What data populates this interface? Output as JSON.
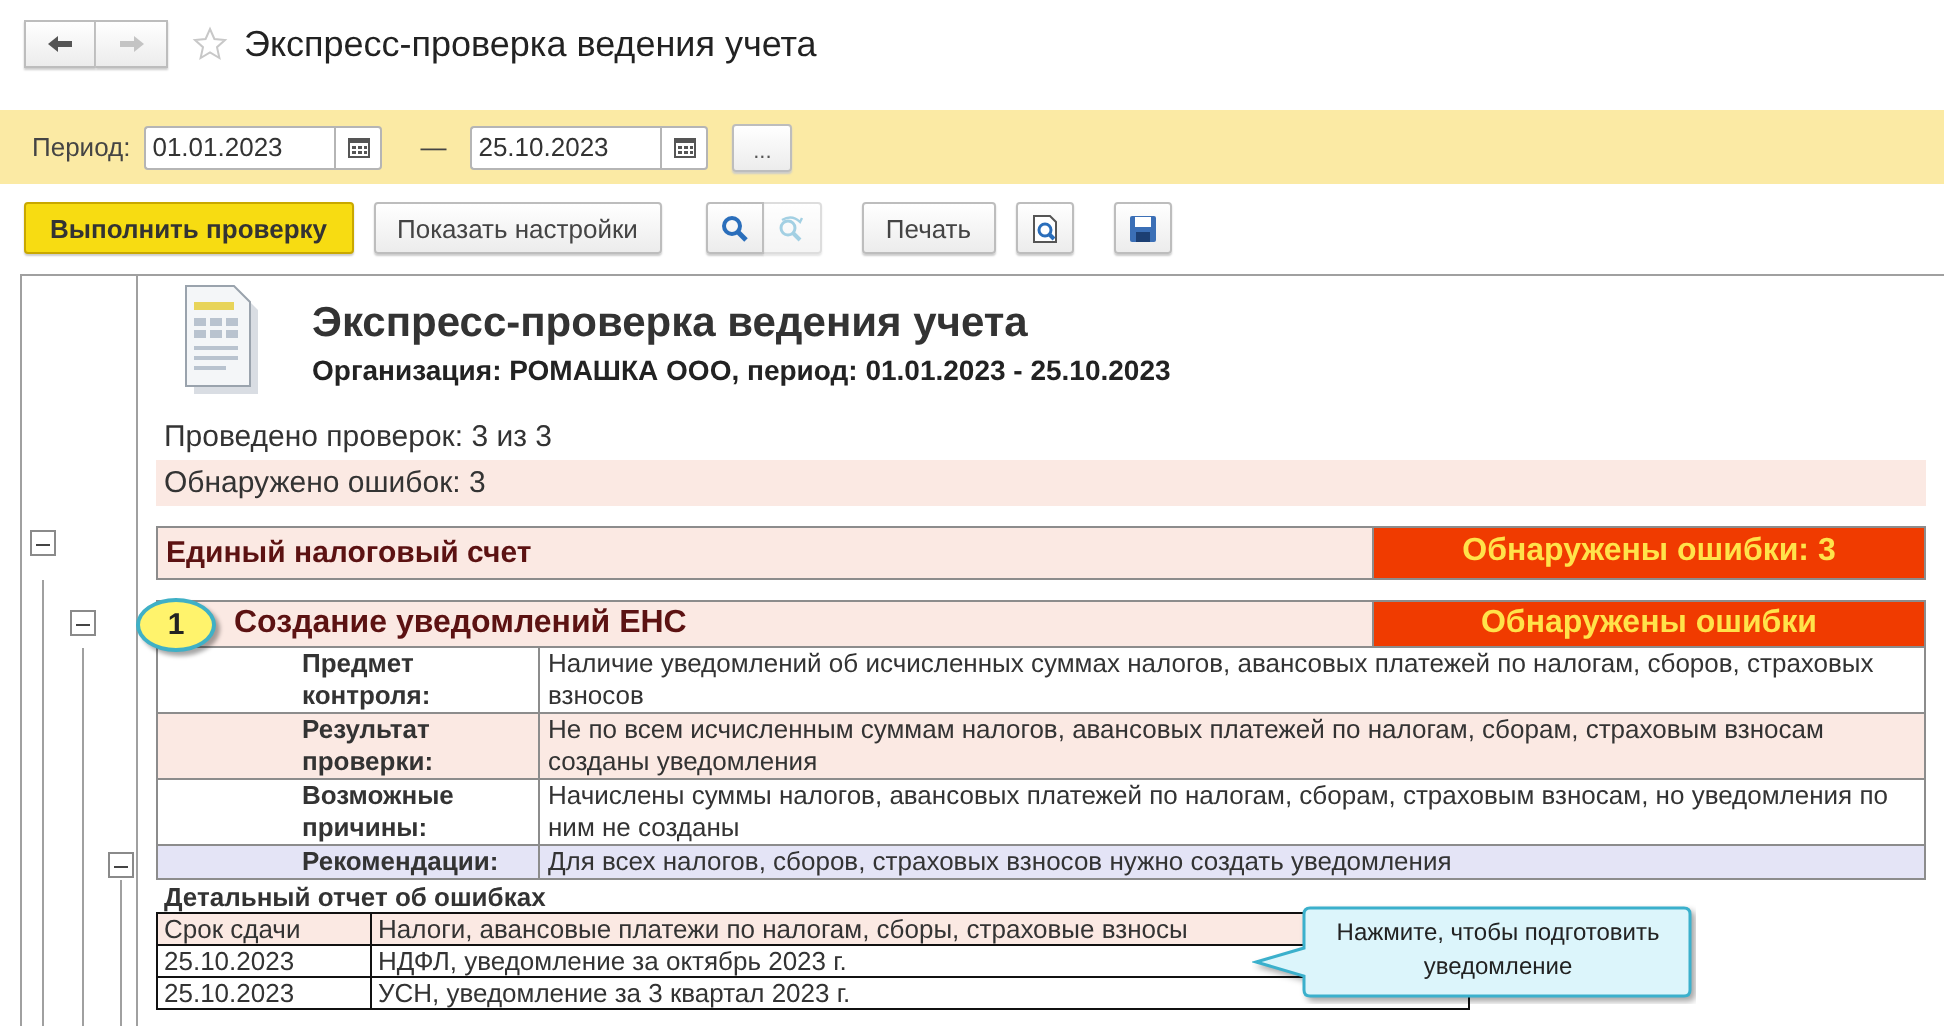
{
  "window": {
    "title": "Экспресс-проверка ведения учета"
  },
  "nav": [
    {
      "kind": "back",
      "disabled": false
    },
    {
      "kind": "forward",
      "disabled": true
    }
  ],
  "period": {
    "label": "Период:",
    "from": "01.01.2023",
    "separator": "—",
    "to": "25.10.2023",
    "more_button": "..."
  },
  "toolbar": [
    {
      "kind": "primary",
      "label": "Выполнить проверку"
    },
    {
      "kind": "button",
      "label": "Показать настройки"
    },
    {
      "kind": "search",
      "disabled": false
    },
    {
      "kind": "search-next",
      "disabled": true
    },
    {
      "kind": "button",
      "label": "Печать"
    },
    {
      "kind": "preview",
      "disabled": false
    },
    {
      "kind": "save",
      "disabled": false
    }
  ],
  "report": {
    "title": "Экспресс-проверка ведения учета",
    "subtitle": "Организация: РОМАШКА ООО, период: 01.01.2023 - 25.10.2023",
    "checks_done": "Проведено проверок: 3 из 3",
    "errors_found": "Обнаружено ошибок: 3",
    "sections": [
      {
        "title": "Единый налоговый счет",
        "status": "Обнаружены ошибки: 3",
        "expanded": true,
        "items": [
          {
            "marker": "1",
            "title": "Создание уведомлений ЕНС",
            "status": "Обнаружены ошибки",
            "expanded": true,
            "details": [
              {
                "kind": "subject",
                "label": "Предмет контроля:",
                "value": "Наличие уведомлений об исчисленных суммах налогов, авансовых платежей по налогам, сборов, страховых взносов"
              },
              {
                "kind": "result",
                "label": "Результат проверки:",
                "value": "Не по всем исчисленным суммам налогов, авансовых платежей по налогам, сборам, страховым взносам созданы уведомления"
              },
              {
                "kind": "cause",
                "label": "Возможные причины:",
                "value": "Начислены суммы налогов, авансовых платежей по налогам, сборам, страховым взносам, но уведомления по ним не созданы"
              },
              {
                "kind": "recommendation",
                "label": "Рекомендации:",
                "value": "Для всех налогов, сборов, страховых взносов нужно создать уведомления"
              }
            ],
            "detail_report": {
              "title": "Детальный отчет об ошибках",
              "expanded": true,
              "columns": [
                "Срок сдачи",
                "Налоги, авансовые платежи по налогам, сборы, страховые взносы"
              ],
              "rows": [
                [
                  "25.10.2023",
                  "НДФЛ, уведомление за октябрь 2023 г."
                ],
                [
                  "25.10.2023",
                  "УСН, уведомление за 3 квартал 2023 г."
                ]
              ]
            }
          }
        ]
      }
    ]
  },
  "callout": {
    "text": "Нажмите, чтобы подготовить уведомление"
  }
}
